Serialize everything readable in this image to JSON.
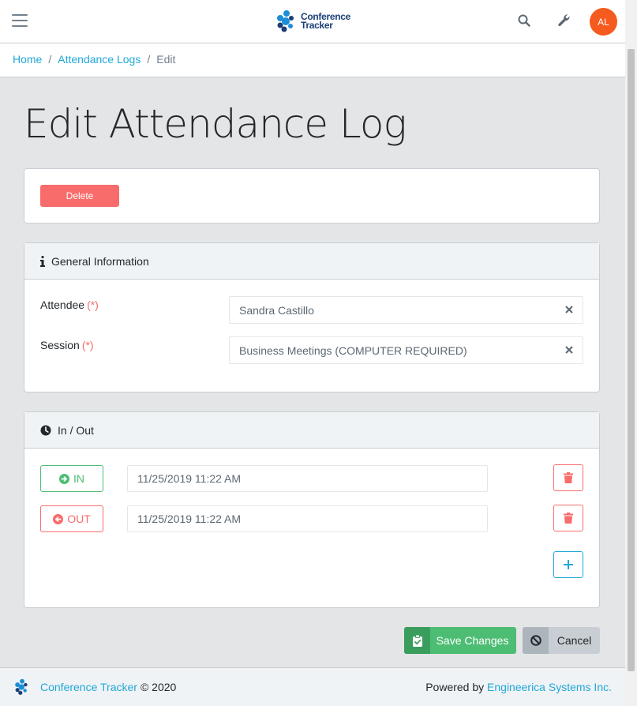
{
  "header": {
    "brand_line1": "Conference",
    "brand_line2": "Tracker",
    "avatar_initials": "AL",
    "icons": [
      "menu-icon",
      "search-icon",
      "wrench-icon"
    ]
  },
  "breadcrumb": {
    "items": [
      {
        "label": "Home"
      },
      {
        "label": "Attendance Logs"
      }
    ],
    "current": "Edit",
    "separator": "/"
  },
  "page": {
    "title": "Edit Attendance Log"
  },
  "actions": {
    "delete_label": "Delete"
  },
  "general": {
    "header": "General Information",
    "fields": [
      {
        "label": "Attendee",
        "required_mark": "(*)",
        "value": "Sandra Castillo"
      },
      {
        "label": "Session",
        "required_mark": "(*)",
        "value": "Business Meetings (COMPUTER REQUIRED)"
      }
    ]
  },
  "inout": {
    "header": "In / Out",
    "entries": [
      {
        "type_label": "IN",
        "time": "11/25/2019 11:22 AM"
      },
      {
        "type_label": "OUT",
        "time": "11/25/2019 11:22 AM"
      }
    ]
  },
  "buttons": {
    "save_label": "Save Changes",
    "cancel_label": "Cancel"
  },
  "footer": {
    "app_name": "Conference Tracker",
    "copyright": "© 2020",
    "powered_by_prefix": "Powered by",
    "company": "Engineerica Systems Inc."
  },
  "colors": {
    "primary": "#20a8d8",
    "success": "#4dbd74",
    "danger": "#f86c6b",
    "avatar": "#f55a1e",
    "brand": "#1b3f77"
  }
}
